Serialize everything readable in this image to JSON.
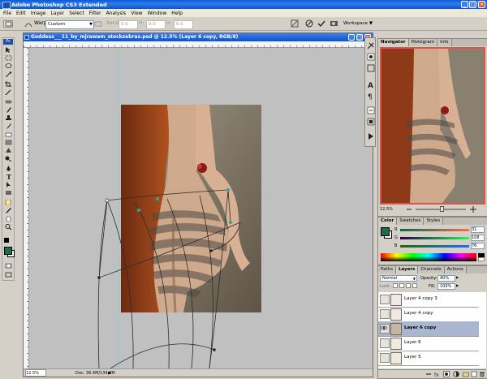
{
  "app": {
    "title": "Adobe Photoshop CS3 Extended"
  },
  "menu": [
    "File",
    "Edit",
    "Image",
    "Layer",
    "Select",
    "Filter",
    "Analysis",
    "View",
    "Window",
    "Help"
  ],
  "options": {
    "warp_label": "Warp:",
    "warp_value": "Custom",
    "bend_label": "Bend:",
    "bend_value": "0.0",
    "h_label": "H:",
    "h_value": "0.0",
    "v_label": "V:",
    "v_value": "0.0",
    "workspace_label": "Workspace"
  },
  "document": {
    "title": "Goddess___11_by_mjrawam_stockzebras.psd @ 12.5% (Layer 6 copy, RGB/8)",
    "zoom": "12.5%",
    "doc_size": "Doc: 36.4M/134.8M"
  },
  "navigator": {
    "tabs": [
      "Navigator",
      "Histogram",
      "Info"
    ],
    "zoom": "12.5%"
  },
  "color_panel": {
    "tabs": [
      "Color",
      "Swatches",
      "Styles"
    ],
    "channels": [
      {
        "label": "R",
        "value": "31"
      },
      {
        "label": "G",
        "value": "108"
      },
      {
        "label": "B",
        "value": "76"
      }
    ],
    "fg_color": "#1f6c4c"
  },
  "layers_panel": {
    "tabs": [
      "Paths",
      "Layers",
      "Channels",
      "Actions"
    ],
    "blend_mode": "Normal",
    "opacity_label": "Opacity:",
    "opacity": "40%",
    "lock_label": "Lock:",
    "fill_label": "Fill:",
    "fill": "100%",
    "layers": [
      {
        "name": "Layer 4 copy 3",
        "selected": false
      },
      {
        "name": "Layer 4 copy",
        "selected": false
      },
      {
        "name": "Layer 6 copy",
        "selected": true
      },
      {
        "name": "Layer 6",
        "selected": false
      },
      {
        "name": "Layer 5",
        "selected": false
      }
    ]
  }
}
